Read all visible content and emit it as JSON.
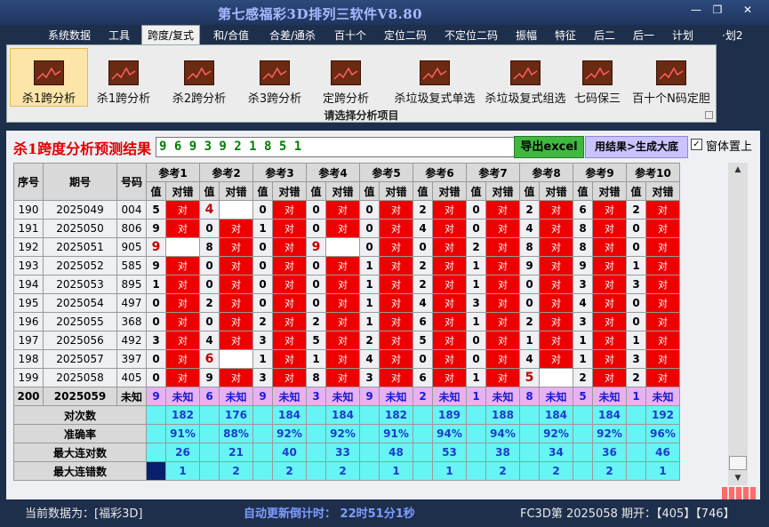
{
  "window": {
    "title": "第七感福彩3D排列三软件V8.80",
    "min": "—",
    "restore": "❐",
    "close": "✕"
  },
  "menu": [
    "系统数据",
    "工具",
    "跨度/复式",
    "和/合值",
    "合差/通杀",
    "百十个",
    "定位二码",
    "不定位二码",
    "振幅",
    "特征",
    "后二",
    "后一",
    "计划",
    "·划2"
  ],
  "ribbon": {
    "buttons": [
      "杀1跨分析",
      "杀1跨分析",
      "杀2跨分析",
      "杀3跨分析",
      "定跨分析",
      "杀垃圾复式单选",
      "杀垃圾复式组选",
      "七码保三",
      "百十个N码定胆"
    ],
    "caption": "请选择分析项目"
  },
  "panel": {
    "title": "杀1跨度分析预测结果",
    "result": "9 6 9 3 9 2 1 8 5 1",
    "excel_btn": "导出excel",
    "gen_btn": "用结果>生成大底",
    "topmost_label": "窗体置上",
    "topmost_checked": "✓"
  },
  "table": {
    "col_seq": "序号",
    "col_period": "期号",
    "col_code": "号码",
    "refs": [
      "参考1",
      "参考2",
      "参考3",
      "参考4",
      "参考5",
      "参考6",
      "参考7",
      "参考8",
      "参考9",
      "参考10"
    ],
    "sub_val": "值",
    "sub_ok": "对错",
    "ok_text": "对",
    "rows": [
      {
        "seq": "190",
        "period": "2025049",
        "code": "004",
        "vals": [
          "5",
          "4",
          "0",
          "0",
          "0",
          "2",
          "0",
          "2",
          "6",
          "2"
        ],
        "hits": [
          1,
          0,
          1,
          1,
          1,
          1,
          1,
          1,
          1,
          1
        ]
      },
      {
        "seq": "191",
        "period": "2025050",
        "code": "806",
        "vals": [
          "9",
          "0",
          "1",
          "0",
          "0",
          "4",
          "0",
          "4",
          "8",
          "0"
        ],
        "hits": [
          1,
          1,
          1,
          1,
          1,
          1,
          1,
          1,
          1,
          1
        ]
      },
      {
        "seq": "192",
        "period": "2025051",
        "code": "905",
        "vals": [
          "9",
          "8",
          "0",
          "9",
          "0",
          "0",
          "2",
          "8",
          "8",
          "0"
        ],
        "hits": [
          0,
          1,
          1,
          0,
          1,
          1,
          1,
          1,
          1,
          1
        ]
      },
      {
        "seq": "193",
        "period": "2025052",
        "code": "585",
        "vals": [
          "9",
          "0",
          "0",
          "0",
          "1",
          "2",
          "1",
          "9",
          "9",
          "1"
        ],
        "hits": [
          1,
          1,
          1,
          1,
          1,
          1,
          1,
          1,
          1,
          1
        ]
      },
      {
        "seq": "194",
        "period": "2025053",
        "code": "895",
        "vals": [
          "1",
          "0",
          "0",
          "0",
          "1",
          "2",
          "1",
          "0",
          "3",
          "3"
        ],
        "hits": [
          1,
          1,
          1,
          1,
          1,
          1,
          1,
          1,
          1,
          1
        ]
      },
      {
        "seq": "195",
        "period": "2025054",
        "code": "497",
        "vals": [
          "0",
          "2",
          "0",
          "0",
          "1",
          "4",
          "3",
          "0",
          "4",
          "0"
        ],
        "hits": [
          1,
          1,
          1,
          1,
          1,
          1,
          1,
          1,
          1,
          1
        ]
      },
      {
        "seq": "196",
        "period": "2025055",
        "code": "368",
        "vals": [
          "0",
          "0",
          "2",
          "2",
          "1",
          "6",
          "1",
          "2",
          "3",
          "0"
        ],
        "hits": [
          1,
          1,
          1,
          1,
          1,
          1,
          1,
          1,
          1,
          1
        ]
      },
      {
        "seq": "197",
        "period": "2025056",
        "code": "492",
        "vals": [
          "3",
          "4",
          "3",
          "5",
          "2",
          "5",
          "0",
          "1",
          "1",
          "1"
        ],
        "hits": [
          1,
          1,
          1,
          1,
          1,
          1,
          1,
          1,
          1,
          1
        ]
      },
      {
        "seq": "198",
        "period": "2025057",
        "code": "397",
        "vals": [
          "0",
          "6",
          "1",
          "1",
          "4",
          "0",
          "0",
          "4",
          "1",
          "3"
        ],
        "hits": [
          1,
          0,
          1,
          1,
          1,
          1,
          1,
          1,
          1,
          1
        ]
      },
      {
        "seq": "199",
        "period": "2025058",
        "code": "405",
        "vals": [
          "0",
          "9",
          "3",
          "8",
          "3",
          "6",
          "1",
          "5",
          "2",
          "2"
        ],
        "hits": [
          1,
          1,
          1,
          1,
          1,
          1,
          1,
          0,
          1,
          1
        ]
      }
    ],
    "pending": {
      "seq": "200",
      "period": "2025059",
      "code": "未知",
      "vals": [
        "9",
        "6",
        "9",
        "3",
        "9",
        "2",
        "1",
        "8",
        "5",
        "1"
      ],
      "status": "未知"
    },
    "stats": [
      {
        "label": "对次数",
        "vals": [
          "182",
          "176",
          "184",
          "184",
          "182",
          "189",
          "188",
          "184",
          "184",
          "192"
        ]
      },
      {
        "label": "准确率",
        "vals": [
          "91%",
          "88%",
          "92%",
          "92%",
          "91%",
          "94%",
          "94%",
          "92%",
          "92%",
          "96%"
        ]
      },
      {
        "label": "最大连对数",
        "vals": [
          "26",
          "21",
          "40",
          "33",
          "48",
          "53",
          "38",
          "34",
          "36",
          "46"
        ]
      },
      {
        "label": "最大连错数",
        "vals": [
          "1",
          "2",
          "2",
          "2",
          "1",
          "1",
          "2",
          "2",
          "2",
          "1"
        ]
      }
    ]
  },
  "status": {
    "current": "当前数据为：[福彩3D]",
    "countdown": "自动更新倒计时：  22时51分1秒",
    "draw": "FC3D第 2025058 期开：【405】【746】"
  },
  "colors": {
    "hit": "#ee0000",
    "pending": "#e8b2f0",
    "stats": "#66f4f4"
  }
}
